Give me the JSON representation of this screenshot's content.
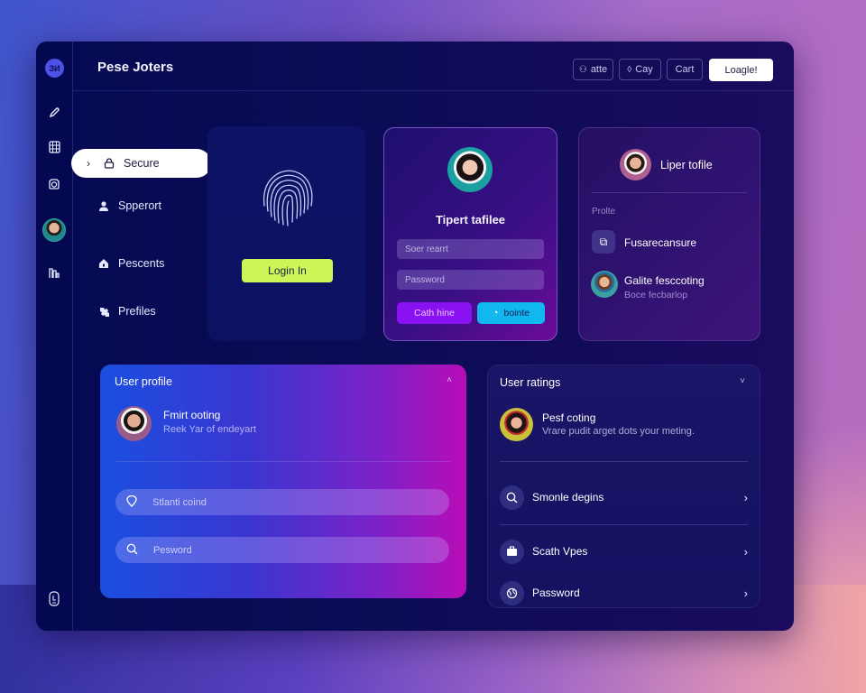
{
  "app": {
    "title": "Pese Joters",
    "logo_text": "ЗИ"
  },
  "header": {
    "buttons": [
      {
        "label": "atte",
        "icon": "people-icon"
      },
      {
        "label": "Cay",
        "icon": "drop-icon"
      },
      {
        "label": "Cart",
        "icon": ""
      },
      {
        "label": "Loagle!",
        "icon": ""
      }
    ]
  },
  "rail": {
    "icons": [
      "pencil-icon",
      "grid-icon",
      "camera-icon",
      "avatar",
      "buildings-icon",
      "phone-lock-icon"
    ]
  },
  "nav": {
    "items": [
      {
        "label": "Secure",
        "icon": "lock-icon",
        "active": true
      },
      {
        "label": "Spperort",
        "icon": "user-icon",
        "active": false
      },
      {
        "label": "Pescents",
        "icon": "house-lock-icon",
        "active": false
      },
      {
        "label": "Prefiles",
        "icon": "puzzle-icon",
        "active": false
      }
    ]
  },
  "fingerprint_card": {
    "button_label": "Login In",
    "accent": "#cdf558"
  },
  "login_card": {
    "title": "Tipert tafilee",
    "username_placeholder": "Soer rearrt",
    "password_placeholder": "Password",
    "primary_button": "Cath hine",
    "secondary_button": "bointe"
  },
  "profile_card": {
    "title": "Liper tofile",
    "section_label": "Prolte",
    "row1_label": "Fusarecansure",
    "row2_title": "Galite fesccoting",
    "row2_sub": "Boce fecbarlop"
  },
  "user_profile": {
    "heading": "User profile",
    "name": "Fmirt ooting",
    "subtitle": "Reek Yar of endeyart",
    "field1_placeholder": "Stlanti coind",
    "field2_placeholder": "Pesword"
  },
  "user_ratings": {
    "heading": "User ratings",
    "name": "Pesf coting",
    "subtitle": "Vrare pudit arget dots your meting.",
    "rows": [
      {
        "label": "Smonle degins",
        "icon": "search-icon"
      },
      {
        "label": "Scath Vpes",
        "icon": "briefcase-icon"
      },
      {
        "label": "Password",
        "icon": "globe-icon"
      }
    ]
  }
}
